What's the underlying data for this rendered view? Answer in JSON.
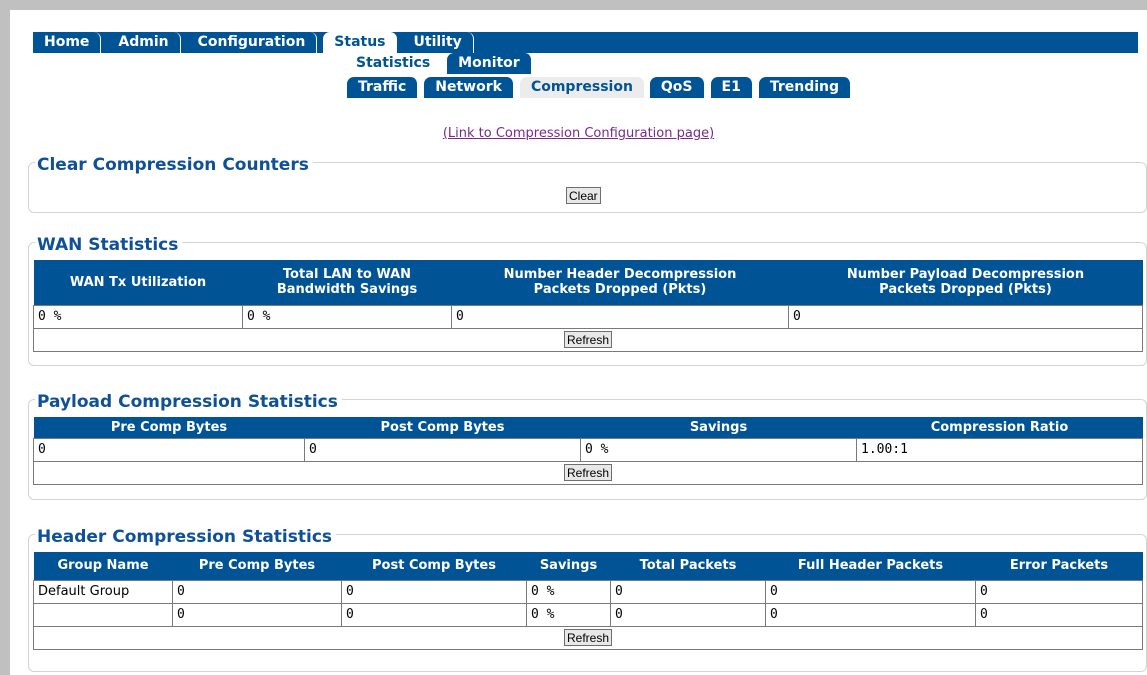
{
  "nav": {
    "main_tabs": [
      "Home",
      "Admin",
      "Configuration",
      "Status",
      "Utility"
    ],
    "status_tabs": [
      "Statistics",
      "Monitor"
    ],
    "stats_tabs": [
      "Traffic",
      "Network",
      "Compression",
      "QoS",
      "E1",
      "Trending"
    ]
  },
  "link_text": "(Link to Compression Configuration page)",
  "clear": {
    "legend": "Clear Compression Counters",
    "button": "Clear"
  },
  "wan": {
    "legend": "WAN Statistics",
    "headers": [
      [
        "WAN Tx Utilization"
      ],
      [
        "Total LAN to WAN",
        "Bandwidth Savings"
      ],
      [
        "Number Header Decompression",
        "Packets Dropped (Pkts)"
      ],
      [
        "Number Payload Decompression",
        "Packets Dropped (Pkts)"
      ]
    ],
    "row": [
      "0 %",
      "0 %",
      "0",
      "0"
    ],
    "refresh": "Refresh"
  },
  "payload": {
    "legend": "Payload Compression Statistics",
    "headers": [
      "Pre Comp Bytes",
      "Post Comp Bytes",
      "Savings",
      "Compression Ratio"
    ],
    "row": [
      "0",
      "0",
      "0 %",
      "1.00:1"
    ],
    "refresh": "Refresh"
  },
  "header": {
    "legend": "Header Compression Statistics",
    "headers": [
      "Group Name",
      "Pre Comp Bytes",
      "Post Comp Bytes",
      "Savings",
      "Total Packets",
      "Full Header Packets",
      "Error Packets"
    ],
    "rows": [
      [
        "Default Group",
        "0",
        "0",
        "0 %",
        "0",
        "0",
        "0"
      ],
      [
        "",
        "0",
        "0",
        "0 %",
        "0",
        "0",
        "0"
      ]
    ],
    "refresh": "Refresh"
  }
}
